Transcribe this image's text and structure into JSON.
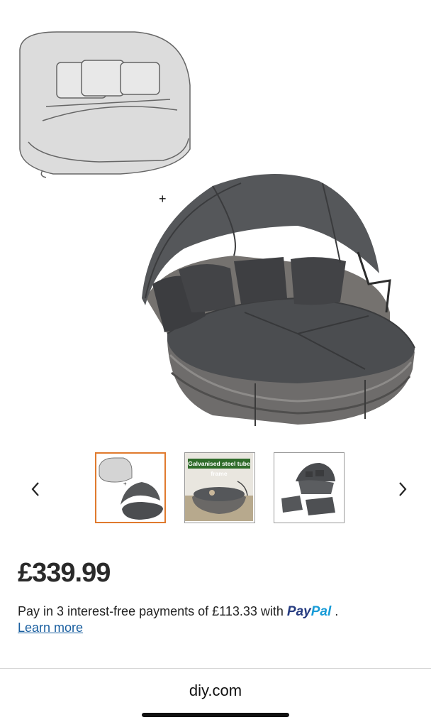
{
  "product": {
    "price": "£339.99",
    "pay_text": "Pay in 3 interest-free payments of £113.33 with",
    "pay_after": ".",
    "paypal_part1": "Pay",
    "paypal_part2": "Pal",
    "learn_more": "Learn more"
  },
  "gallery": {
    "plus_sign": "+",
    "thumb2_caption": "Galvanised steel tube frame",
    "prev_icon": "chevron-left-icon",
    "next_icon": "chevron-right-icon"
  },
  "browser": {
    "domain": "diy.com"
  },
  "colors": {
    "active_border": "#e07a2e",
    "paypal_dark": "#253b80",
    "paypal_light": "#179bd7",
    "link": "#1a5fa0"
  }
}
